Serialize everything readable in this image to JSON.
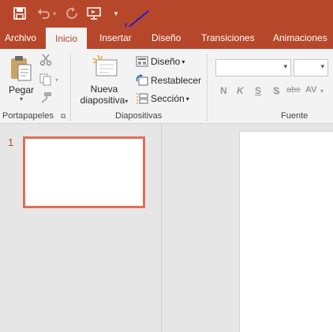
{
  "ribbon_tabs": [
    {
      "label": "Archivo",
      "active": false
    },
    {
      "label": "Inicio",
      "active": true
    },
    {
      "label": "Insertar",
      "active": false
    },
    {
      "label": "Diseño",
      "active": false
    },
    {
      "label": "Transiciones",
      "active": false
    },
    {
      "label": "Animaciones",
      "active": false
    }
  ],
  "groups": {
    "clipboard": {
      "paste_label": "Pegar",
      "group_label": "Portapapeles"
    },
    "slides": {
      "new_slide_line1": "Nueva",
      "new_slide_line2": "diapositiva",
      "layout_label": "Diseño",
      "reset_label": "Restablecer",
      "section_label": "Sección",
      "group_label": "Diapositivas"
    },
    "font": {
      "group_label": "Fuente",
      "tools": [
        "N",
        "K",
        "S",
        "S",
        "abc",
        "AV"
      ]
    }
  },
  "slides_panel": {
    "slide_number": "1"
  },
  "colors": {
    "accent": "#b7472a",
    "thumb_border": "#e06f5a",
    "annotation": "#1a1ad6"
  }
}
